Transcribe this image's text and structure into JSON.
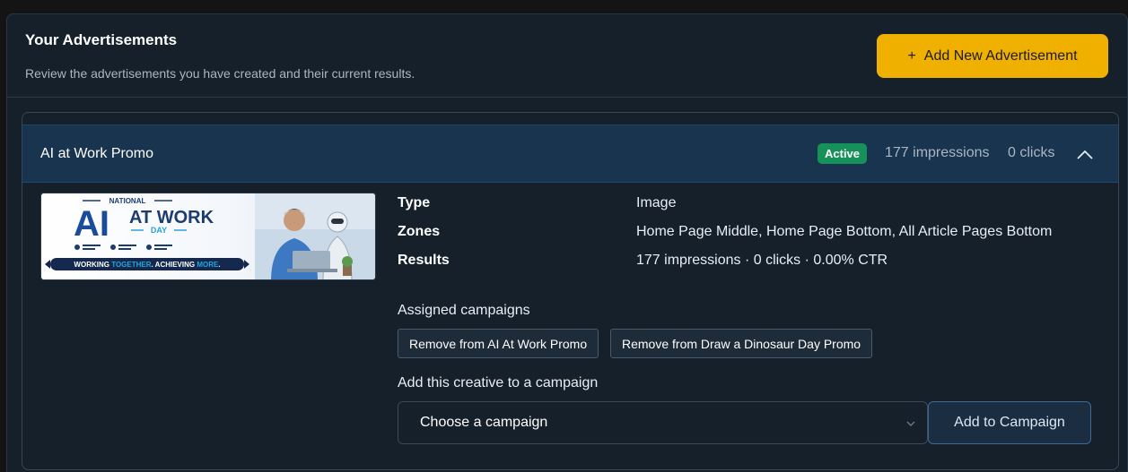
{
  "header": {
    "title": "Your Advertisements",
    "subtitle": "Review the advertisements you have created and their current results.",
    "add_button_icon": "+",
    "add_button_label": "Add New Advertisement"
  },
  "ad": {
    "title": "AI at Work Promo",
    "status": "Active",
    "impressions": "177 impressions",
    "clicks": "0 clicks",
    "image": {
      "line1": "NATIONAL",
      "line2a": "AI",
      "line2b": "AT WORK",
      "line3": "DAY",
      "tagline_a": "WORKING ",
      "tagline_b": "TOGETHER",
      "tagline_c": ". ACHIEVING ",
      "tagline_d": "MORE",
      "tagline_e": "."
    },
    "details": [
      {
        "label": "Type",
        "value": "Image"
      },
      {
        "label": "Zones",
        "value": "Home Page Middle, Home Page Bottom, All Article Pages Bottom"
      },
      {
        "label": "Results",
        "value": "177 impressions · 0 clicks · 0.00% CTR"
      }
    ],
    "assigned_label": "Assigned campaigns",
    "assigned_buttons": [
      "Remove from AI At Work Promo",
      "Remove from Draw a Dinosaur Day Promo"
    ],
    "add_label": "Add this creative to a campaign",
    "select_value": "Choose a campaign",
    "add_campaign_button": "Add to Campaign"
  },
  "colors": {
    "accent": "#f0b000",
    "active_badge": "#17915a",
    "panel_bg": "#15202b",
    "card_header_bg": "#19344f"
  }
}
